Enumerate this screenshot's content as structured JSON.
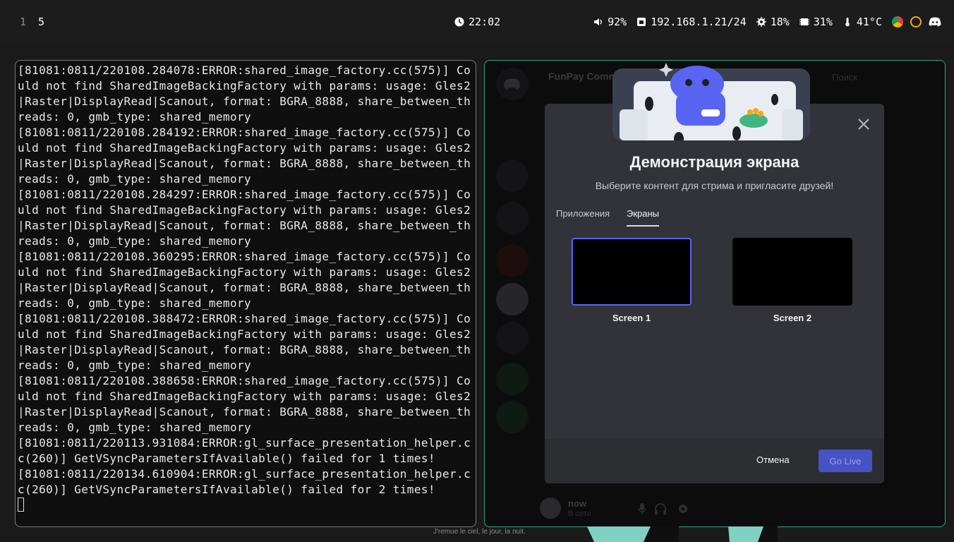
{
  "workspaces": [
    "1",
    "5"
  ],
  "clock": "22:02",
  "status": {
    "volume": "92%",
    "ip": "192.168.1.21/24",
    "cpu": "18%",
    "memory": "31%",
    "temperature": "41°C"
  },
  "tray_icons": [
    "chromium-icon",
    "power-icon",
    "discord-icon"
  ],
  "terminal": {
    "lines": [
      "[81081:0811/220108.284078:ERROR:shared_image_factory.cc(575)] Co",
      "uld not find SharedImageBackingFactory with params: usage: Gles2",
      "|Raster|DisplayRead|Scanout, format: BGRA_8888, share_between_th",
      "reads: 0, gmb_type: shared_memory",
      "[81081:0811/220108.284192:ERROR:shared_image_factory.cc(575)] Co",
      "uld not find SharedImageBackingFactory with params: usage: Gles2",
      "|Raster|DisplayRead|Scanout, format: BGRA_8888, share_between_th",
      "reads: 0, gmb_type: shared_memory",
      "[81081:0811/220108.284297:ERROR:shared_image_factory.cc(575)] Co",
      "uld not find SharedImageBackingFactory with params: usage: Gles2",
      "|Raster|DisplayRead|Scanout, format: BGRA_8888, share_between_th",
      "reads: 0, gmb_type: shared_memory",
      "[81081:0811/220108.360295:ERROR:shared_image_factory.cc(575)] Co",
      "uld not find SharedImageBackingFactory with params: usage: Gles2",
      "|Raster|DisplayRead|Scanout, format: BGRA_8888, share_between_th",
      "reads: 0, gmb_type: shared_memory",
      "[81081:0811/220108.388472:ERROR:shared_image_factory.cc(575)] Co",
      "uld not find SharedImageBackingFactory with params: usage: Gles2",
      "|Raster|DisplayRead|Scanout, format: BGRA_8888, share_between_th",
      "reads: 0, gmb_type: shared_memory",
      "[81081:0811/220108.388658:ERROR:shared_image_factory.cc(575)] Co",
      "uld not find SharedImageBackingFactory with params: usage: Gles2",
      "|Raster|DisplayRead|Scanout, format: BGRA_8888, share_between_th",
      "reads: 0, gmb_type: shared_memory",
      "[81081:0811/220113.931084:ERROR:gl_surface_presentation_helper.c",
      "c(260)] GetVSyncParametersIfAvailable() failed for 1 times!",
      "[81081:0811/220134.610904:ERROR:gl_surface_presentation_helper.c",
      "c(260)] GetVSyncParametersIfAvailable() failed for 2 times!"
    ]
  },
  "discord_bg": {
    "server_name": "FunPay Community",
    "search": "Поиск",
    "user": {
      "name": "now",
      "status": "В сети"
    }
  },
  "modal": {
    "title": "Демонстрация экрана",
    "subtitle": "Выберите контент для стрима и пригласите друзей!",
    "tabs": [
      "Приложения",
      "Экраны"
    ],
    "active_tab": "Экраны",
    "screens": [
      "Screen 1",
      "Screen 2"
    ],
    "selected_screen": "Screen 1",
    "cancel_label": "Отмена",
    "golive_label": "Go Live"
  },
  "wallpaper_text": "J'remue le ciel, le jour, la nuit.",
  "colors": {
    "accent": "#5865f2",
    "golive_bg": "#4752c4",
    "discord_border": "#2fa38a",
    "modal_bg": "#313338"
  }
}
